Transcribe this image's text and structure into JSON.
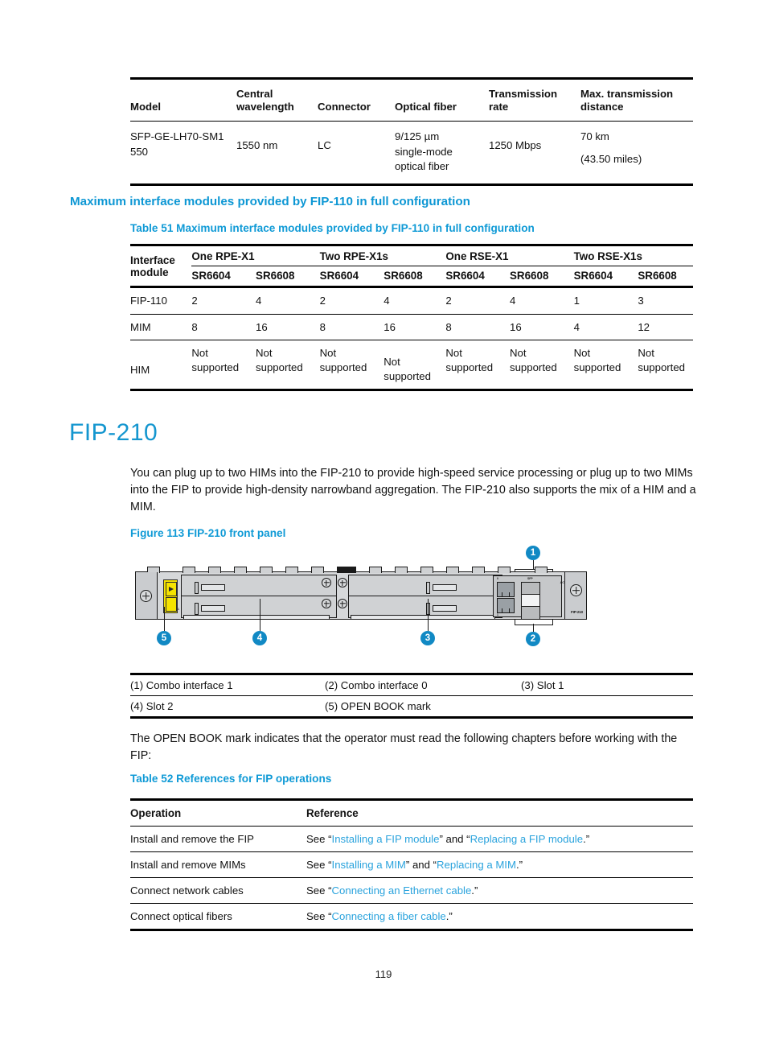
{
  "page": {
    "number": "119"
  },
  "table_50": {
    "headers": [
      "Model",
      "Central wavelength",
      "Connector",
      "Optical fiber",
      "Transmission rate",
      "Max. transmission distance"
    ],
    "rows": [
      {
        "model": "SFP-GE-LH70-SM1550",
        "wavelength": "1550 nm",
        "connector": "LC",
        "fiber": "9/125 µm single-mode optical fiber",
        "rate": "1250 Mbps",
        "distance_km": "70 km",
        "distance_miles": "(43.50 miles)"
      }
    ]
  },
  "section_heading": "Maximum interface modules provided by FIP-110 in full configuration",
  "table_51": {
    "caption": "Table 51 Maximum interface modules provided by FIP-110 in full configuration",
    "row_header": "Interface module",
    "groups": [
      "One RPE-X1",
      "Two RPE-X1s",
      "One RSE-X1",
      "Two RSE-X1s"
    ],
    "subheaders": [
      "SR6604",
      "SR6608",
      "SR6604",
      "SR6608",
      "SR6604",
      "SR6608",
      "SR6604",
      "SR6608"
    ],
    "rows": [
      {
        "label": "FIP-110",
        "values": [
          "2",
          "4",
          "2",
          "4",
          "2",
          "4",
          "1",
          "3"
        ]
      },
      {
        "label": "MIM",
        "values": [
          "8",
          "16",
          "8",
          "16",
          "8",
          "16",
          "4",
          "12"
        ]
      },
      {
        "label": "HIM",
        "values": [
          "Not supported",
          "Not supported",
          "Not supported",
          "Not supported",
          "Not supported",
          "Not supported",
          "Not supported",
          "Not supported"
        ]
      }
    ]
  },
  "fip210": {
    "title": "FIP-210",
    "intro": "You can plug up to two HIMs into the FIP-210 to provide high-speed service processing or plug up to two MIMs into the FIP to provide high-density narrowband aggregation. The FIP-210 also supports the mix of a HIM and a MIM.",
    "figure_caption": "Figure 113 FIP-210 front panel"
  },
  "figure": {
    "callouts": [
      "1",
      "2",
      "3",
      "4",
      "5"
    ],
    "device_silkscreen": "FIP-210",
    "led_labels": [
      "ACT",
      "LINK",
      "SPD"
    ],
    "port_labels": [
      "0",
      "1"
    ],
    "legend": [
      [
        "(1) Combo interface 1",
        "(2) Combo interface 0",
        "(3) Slot 1"
      ],
      [
        "(4) Slot 2",
        "(5) OPEN BOOK mark",
        ""
      ]
    ]
  },
  "openbook_paragraph": "The OPEN BOOK mark indicates that the operator must read the following chapters before working with the FIP:",
  "table_52": {
    "caption": "Table 52 References for FIP operations",
    "headers": [
      "Operation",
      "Reference"
    ],
    "rows": [
      {
        "operation": "Install and remove the FIP",
        "prefix": "See “",
        "link1": "Installing a FIP module",
        "mid": "” and “",
        "link2": "Replacing a FIP module",
        "suffix": ".”"
      },
      {
        "operation": "Install and remove MIMs",
        "prefix": "See “",
        "link1": "Installing a MIM",
        "mid": "” and “",
        "link2": "Replacing a MIM",
        "suffix": ".”"
      },
      {
        "operation": "Connect network cables",
        "prefix": "See “",
        "link1": "Connecting an Ethernet cable",
        "mid": "",
        "link2": "",
        "suffix": ".”"
      },
      {
        "operation": "Connect optical fibers",
        "prefix": "See “",
        "link1": "Connecting a fiber cable",
        "mid": "",
        "link2": "",
        "suffix": ".”"
      }
    ]
  }
}
